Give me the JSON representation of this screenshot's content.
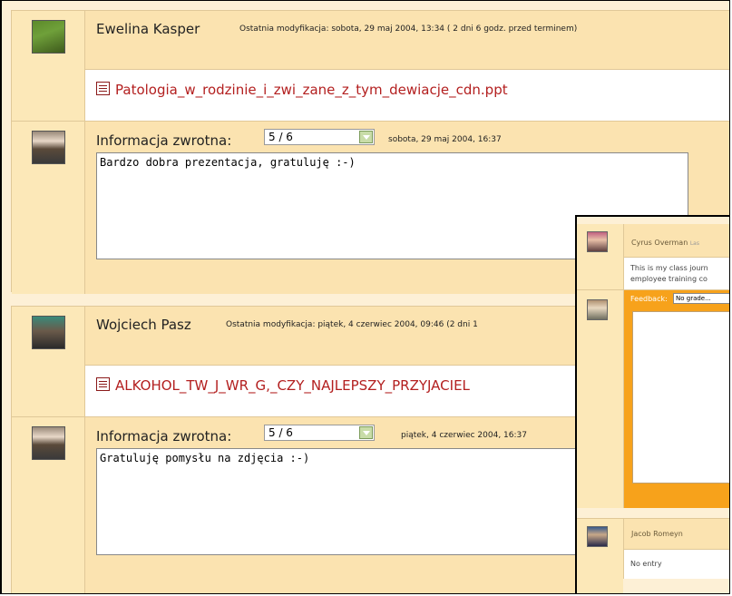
{
  "submissions": [
    {
      "student_name": "Ewelina Kasper",
      "modified_label": "Ostatnia modyfikacja: sobota, 29 maj 2004, 13:34  ( 2 dni 6 godz. przed terminem)",
      "file_name": "Patologia_w_rodzinie_i_zwi_zane_z_tym_dewiacje_cdn.ppt",
      "feedback_label": "Informacja zwrotna:",
      "grade": "5 / 6",
      "feedback_date": "sobota, 29 maj 2004, 16:37",
      "comment": "Bardzo dobra prezentacja, gratuluję :-)"
    },
    {
      "student_name": "Wojciech Pasz",
      "modified_label": "Ostatnia modyfikacja: piątek, 4 czerwiec 2004, 09:46 (2 dni 1",
      "file_name": "ALKOHOL_TW_J_WR_G,_CZY_NAJLEPSZY_PRZYJACIEL",
      "feedback_label": "Informacja zwrotna:",
      "grade": "5 / 6",
      "feedback_date": "piątek, 4 czerwiec 2004, 16:37",
      "comment": "Gratuluję pomysłu na zdjęcia :-)"
    }
  ],
  "overlay": {
    "entry1_name": "Cyrus Overman",
    "entry1_meta": "Las",
    "entry1_text_line1": "This is my class journ",
    "entry1_text_line2": "employee training co",
    "feedback_label": "Feedback:",
    "grade_placeholder": "No grade...",
    "entry2_name": "Jacob Romeyn",
    "entry2_text": "No entry"
  },
  "colors": {
    "header_bg": "#fbe3b0",
    "link": "#b31f1f",
    "overlay_accent": "#f7a21b"
  }
}
